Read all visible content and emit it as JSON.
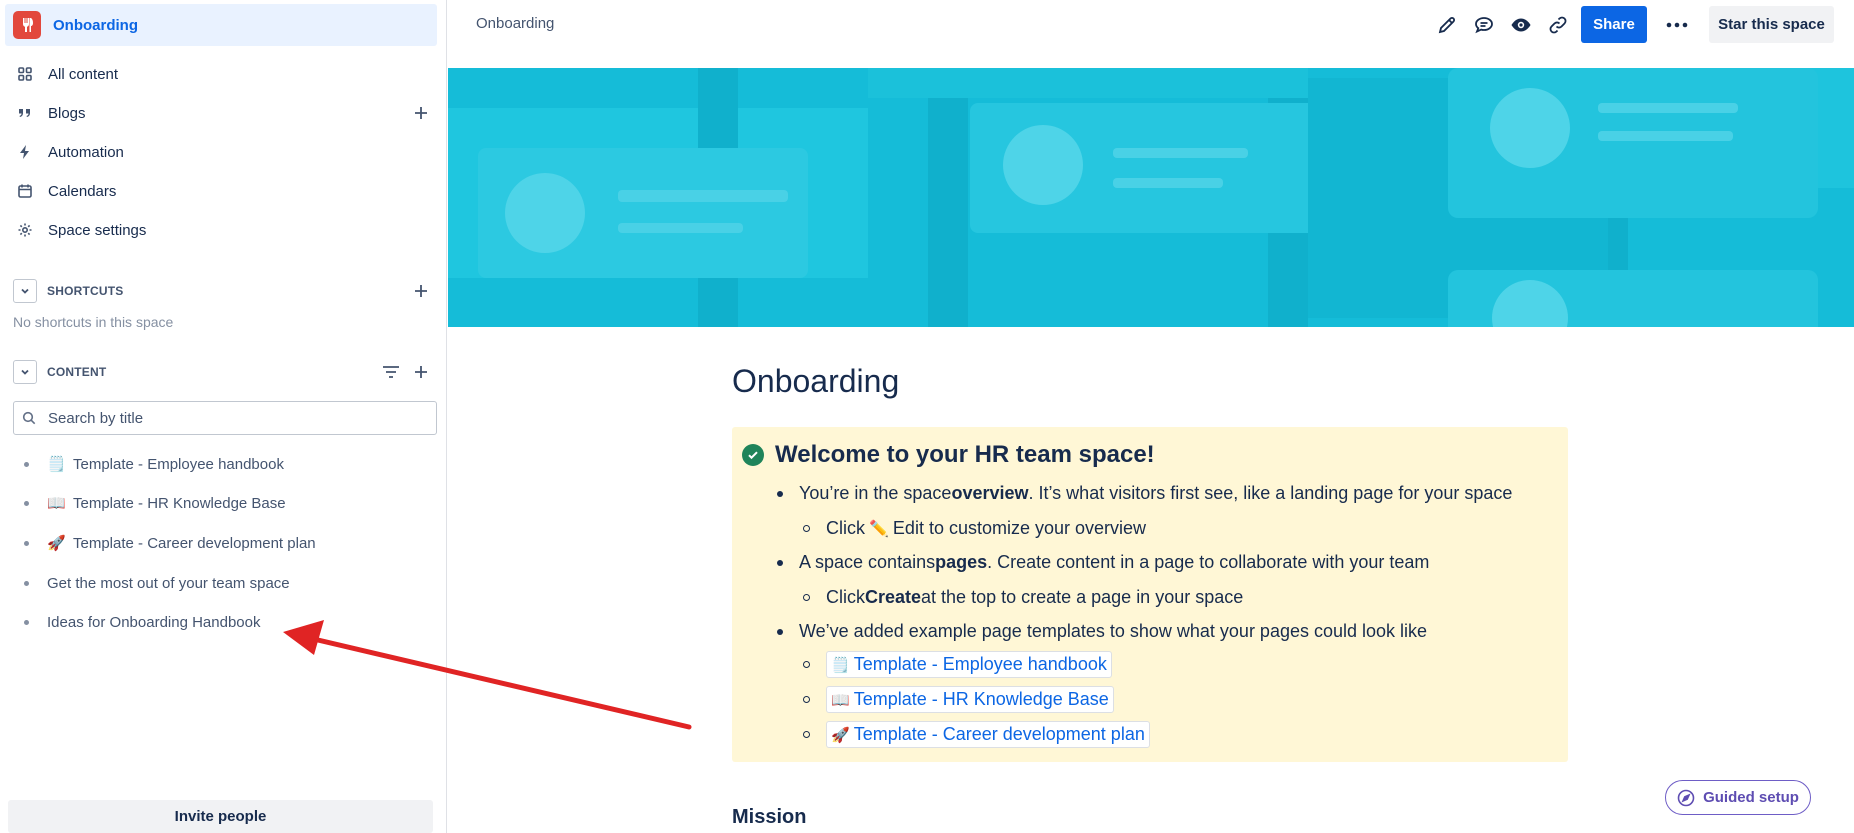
{
  "sidebar": {
    "space_name": "Onboarding",
    "nav": [
      {
        "label": "All content",
        "icon": "grid-icon"
      },
      {
        "label": "Blogs",
        "icon": "quote-icon"
      },
      {
        "label": "Automation",
        "icon": "lightning-icon"
      },
      {
        "label": "Calendars",
        "icon": "calendar-icon"
      },
      {
        "label": "Space settings",
        "icon": "gear-icon"
      }
    ],
    "shortcuts": {
      "title": "SHORTCUTS",
      "empty_text": "No shortcuts in this space"
    },
    "content": {
      "title": "CONTENT",
      "search_placeholder": "Search by title",
      "items": [
        {
          "emoji": "🗒️",
          "label": "Template - Employee handbook"
        },
        {
          "emoji": "📖",
          "label": "Template - HR Knowledge Base"
        },
        {
          "emoji": "🚀",
          "label": "Template - Career development plan"
        },
        {
          "emoji": "",
          "label": "Get the most out of your team space"
        },
        {
          "emoji": "",
          "label": "Ideas for Onboarding Handbook"
        }
      ]
    },
    "invite_label": "Invite people"
  },
  "topbar": {
    "breadcrumb": "Onboarding",
    "share_label": "Share",
    "star_label": "Star this space"
  },
  "page": {
    "title": "Onboarding",
    "panel_title": "Welcome to your HR team space!",
    "lines": {
      "l1a": "You’re in the space ",
      "l1b": "overview",
      "l1c": ". It’s what visitors first see, like a landing page for your space",
      "l2a": "Click ",
      "l2emoji": "✏️",
      "l2b": "Edit to customize your overview",
      "l3a": "A space contains ",
      "l3b": "pages",
      "l3c": ". Create content in a page to collaborate with your team",
      "l4a": "Click ",
      "l4b": "Create",
      "l4c": " at the top to create a page in your space",
      "l5": "We’ve added example page templates to show what your pages could look like"
    },
    "template_links": [
      {
        "emoji": "🗒️",
        "label": "Template - Employee handbook"
      },
      {
        "emoji": "📖",
        "label": "Template - HR Knowledge Base"
      },
      {
        "emoji": "🚀",
        "label": "Template - Career development plan"
      }
    ],
    "mission_heading": "Mission"
  },
  "guided_setup_label": "Guided setup",
  "colors": {
    "accent": "#0c66e4",
    "banner": "#15bcd8",
    "panel": "#fff7d6",
    "annotation_arrow": "#e02424",
    "logo": "#e2483d"
  }
}
